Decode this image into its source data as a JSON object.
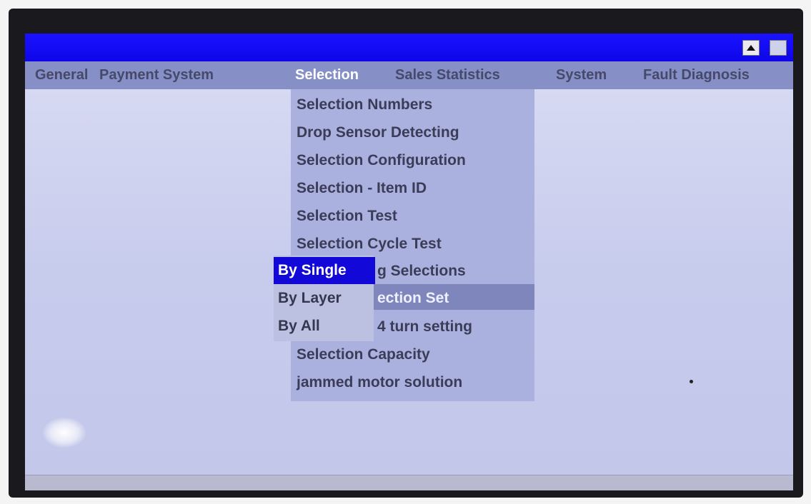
{
  "menubar": {
    "items": [
      {
        "label": "General"
      },
      {
        "label": "Payment System"
      },
      {
        "label": "Selection"
      },
      {
        "label": "Sales Statistics"
      },
      {
        "label": "System"
      },
      {
        "label": "Fault Diagnosis"
      }
    ],
    "active": "Selection"
  },
  "dropdown": {
    "items": [
      {
        "label": "Selection Numbers"
      },
      {
        "label": "Drop Sensor Detecting"
      },
      {
        "label": "Selection Configuration"
      },
      {
        "label": "Selection - Item ID"
      },
      {
        "label": "Selection Test"
      },
      {
        "label": "Selection Cycle Test"
      },
      {
        "label": "g Selections"
      },
      {
        "label": "ection Set"
      },
      {
        "label": "4 turn setting"
      },
      {
        "label": "Selection Capacity"
      },
      {
        "label": "jammed motor solution"
      }
    ],
    "highlighted": "ection Set"
  },
  "submenu": {
    "items": [
      {
        "label": "By Single"
      },
      {
        "label": "By Layer"
      },
      {
        "label": "By All"
      }
    ],
    "selected": "By Single"
  },
  "colors": {
    "titlebar": "#1a12ff",
    "menubar": "#8790c6",
    "selection_highlight": "#1208d8",
    "screen_background": "#c9cde8"
  },
  "icons": {
    "scroll_up": "triangle-up-icon"
  }
}
